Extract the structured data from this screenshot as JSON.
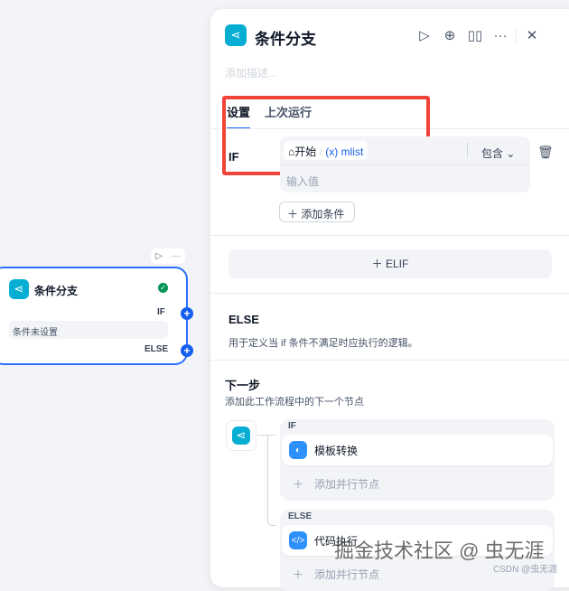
{
  "canvas_node": {
    "title": "条件分支",
    "if_label": "IF",
    "else_label": "ELSE",
    "condition_text": "条件未设置",
    "status": "success"
  },
  "panel": {
    "title": "条件分支",
    "description_placeholder": "添加描述...",
    "header_icons": [
      "play-icon",
      "locate-icon",
      "book-icon",
      "more-icon",
      "close-icon"
    ],
    "tabs": [
      {
        "label": "设置",
        "active": true
      },
      {
        "label": "上次运行",
        "active": false
      }
    ],
    "if_section": {
      "label": "IF",
      "variable_source": "开始",
      "variable_separator": "/",
      "variable_prefix": "(x)",
      "variable_name": "mlist",
      "operator": "包含",
      "value_placeholder": "输入值",
      "add_condition": "添加条件"
    },
    "elif_button": "ELIF",
    "else_section": {
      "title": "ELSE",
      "description": "用于定义当 if 条件不满足时应执行的逻辑。"
    },
    "next_step": {
      "title": "下一步",
      "description": "添加此工作流程中的下一个节点",
      "branches": [
        {
          "label": "IF",
          "node": "模板转换",
          "add_parallel": "添加并行节点"
        },
        {
          "label": "ELSE",
          "node": "代码执行",
          "add_parallel": "添加并行节点"
        }
      ]
    }
  },
  "watermark": {
    "main": "掘金技术社区 @ 虫无涯",
    "sub": "CSDN @虫无涯"
  },
  "colors": {
    "accent": "#155eef",
    "highlight_box": "#f04438",
    "node_icon": "#06aed4"
  }
}
